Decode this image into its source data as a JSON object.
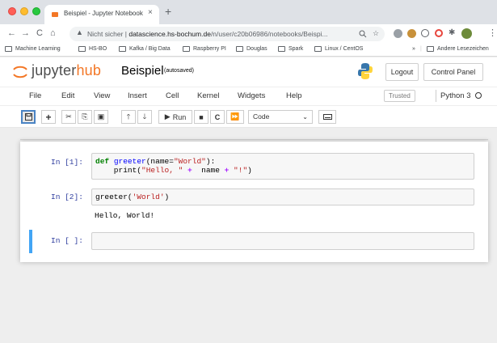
{
  "browser": {
    "tab_title": "Beispiel - Jupyter Notebook",
    "tab_close": "×",
    "new_tab": "+",
    "not_secure": "Nicht sicher",
    "url_host": "datascience.hs-bochum.de",
    "url_path": "/n/user/c20b06986/notebooks/Beispi...",
    "nav": {
      "back": "←",
      "forward": "→",
      "reload": "C",
      "home": "⌂"
    },
    "bookmarks": [
      {
        "label": "Machine Learning"
      },
      {
        "label": "HS-BO"
      },
      {
        "label": "Kafka / Big Data"
      },
      {
        "label": "Raspberry PI"
      },
      {
        "label": "Douglas"
      },
      {
        "label": "Spark"
      },
      {
        "label": "Linux / CentOS"
      }
    ],
    "bookmarks_more": "»",
    "other_bookmarks": "Andere Lesezeichen"
  },
  "jupyter": {
    "logo_left": "jupyter",
    "logo_right": "hub",
    "notebook_name": "Beispiel",
    "autosave": "(autosaved)",
    "logout": "Logout",
    "control_panel": "Control Panel",
    "menu": [
      "File",
      "Edit",
      "View",
      "Insert",
      "Cell",
      "Kernel",
      "Widgets",
      "Help"
    ],
    "trusted": "Trusted",
    "kernel": "Python 3",
    "toolbar": {
      "run_label": "Run",
      "cell_type": "Code"
    }
  },
  "cells": [
    {
      "prompt": "In [1]:",
      "code_line1_kw": "def",
      "code_line1_fn": "greeter",
      "code_line1_a": "(name=",
      "code_line1_str": "\"World\"",
      "code_line1_b": "):",
      "code_line2_a": "    print(",
      "code_line2_str1": "\"Hello, \"",
      "code_line2_op1": " + ",
      "code_line2_mid": " name ",
      "code_line2_op2": "+",
      "code_line2_str2": " \"!\"",
      "code_line2_b": ")"
    },
    {
      "prompt": "In [2]:",
      "code_a": "greeter(",
      "code_str": "'World'",
      "code_b": ")",
      "output": "Hello, World!"
    },
    {
      "prompt": "In [ ]:",
      "code": ""
    }
  ],
  "colors": {
    "accent": "#f37726",
    "prompt": "#303f9f",
    "selected_cell": "#42a5f5"
  }
}
